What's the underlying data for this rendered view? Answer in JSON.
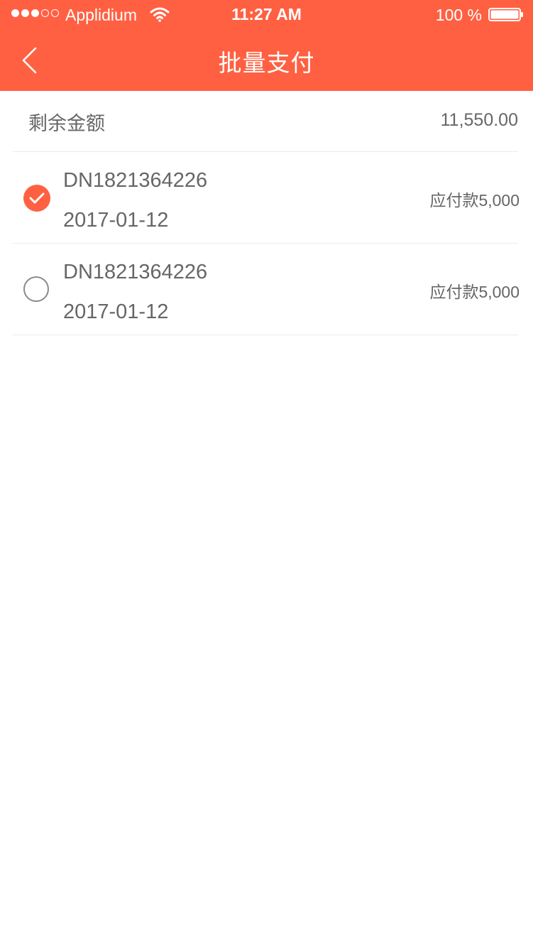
{
  "status_bar": {
    "carrier": "Applidium",
    "time": "11:27 AM",
    "battery": "100 %"
  },
  "nav": {
    "title": "批量支付",
    "back_icon": "chevron-left-icon"
  },
  "balance": {
    "label": "剩余金额",
    "value": "11,550.00"
  },
  "payments": [
    {
      "order_no": "DN1821364226",
      "date": "2017-01-12",
      "amount": "应付款5,000",
      "selected": true
    },
    {
      "order_no": "DN1821364226",
      "date": "2017-01-12",
      "amount": "应付款5,000",
      "selected": false
    }
  ],
  "colors": {
    "accent": "#ff6042",
    "text": "#666666",
    "divider": "#ececec"
  }
}
